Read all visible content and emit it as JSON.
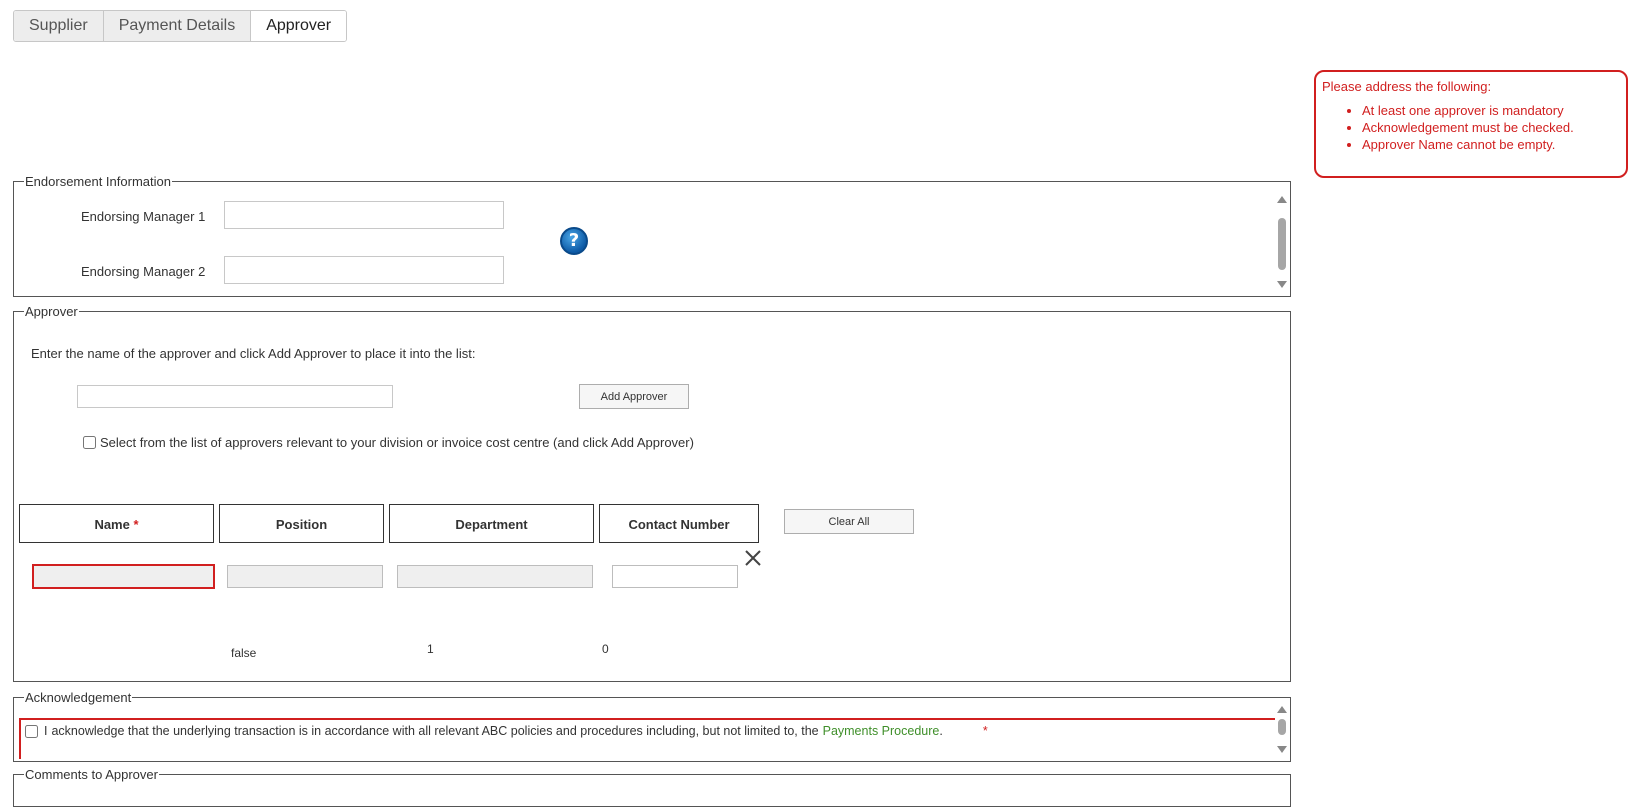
{
  "tabs": [
    {
      "label": "Supplier",
      "active": false
    },
    {
      "label": "Payment Details",
      "active": false
    },
    {
      "label": "Approver",
      "active": true
    }
  ],
  "validation": {
    "heading": "Please address the following:",
    "errors": [
      "At least one approver is mandatory",
      "Acknowledgement must be checked.",
      "Approver Name cannot be empty."
    ],
    "color": "#d11f1f"
  },
  "endorsement": {
    "legend": "Endorsement Information",
    "manager1_label": "Endorsing Manager 1",
    "manager1_value": "",
    "manager2_label": "Endorsing Manager 2",
    "manager2_value": "",
    "help_glyph": "?"
  },
  "approver": {
    "legend": "Approver",
    "instruction": "Enter the name of the approver and click Add Approver to place it into the list:",
    "name_input_value": "",
    "add_button": "Add Approver",
    "select_list_label": "Select from the list of approvers relevant to your division or invoice cost centre (and click Add Approver)",
    "clear_all_button": "Clear All",
    "columns": {
      "name": "Name",
      "name_required": "*",
      "position": "Position",
      "department": "Department",
      "contact": "Contact Number"
    },
    "hidden_values": {
      "flag": "false",
      "count": "1",
      "index": "0"
    }
  },
  "acknowledgement": {
    "legend": "Acknowledgement",
    "prefix": "I",
    "text": "acknowledge that the underlying transaction is in accordance with all relevant ABC policies and procedures including, but not limited to, the",
    "link": "Payments Procedure",
    "suffix": ".",
    "required_mark": "*",
    "link_color": "#3f8f2a"
  },
  "comments": {
    "legend": "Comments to Approver"
  }
}
